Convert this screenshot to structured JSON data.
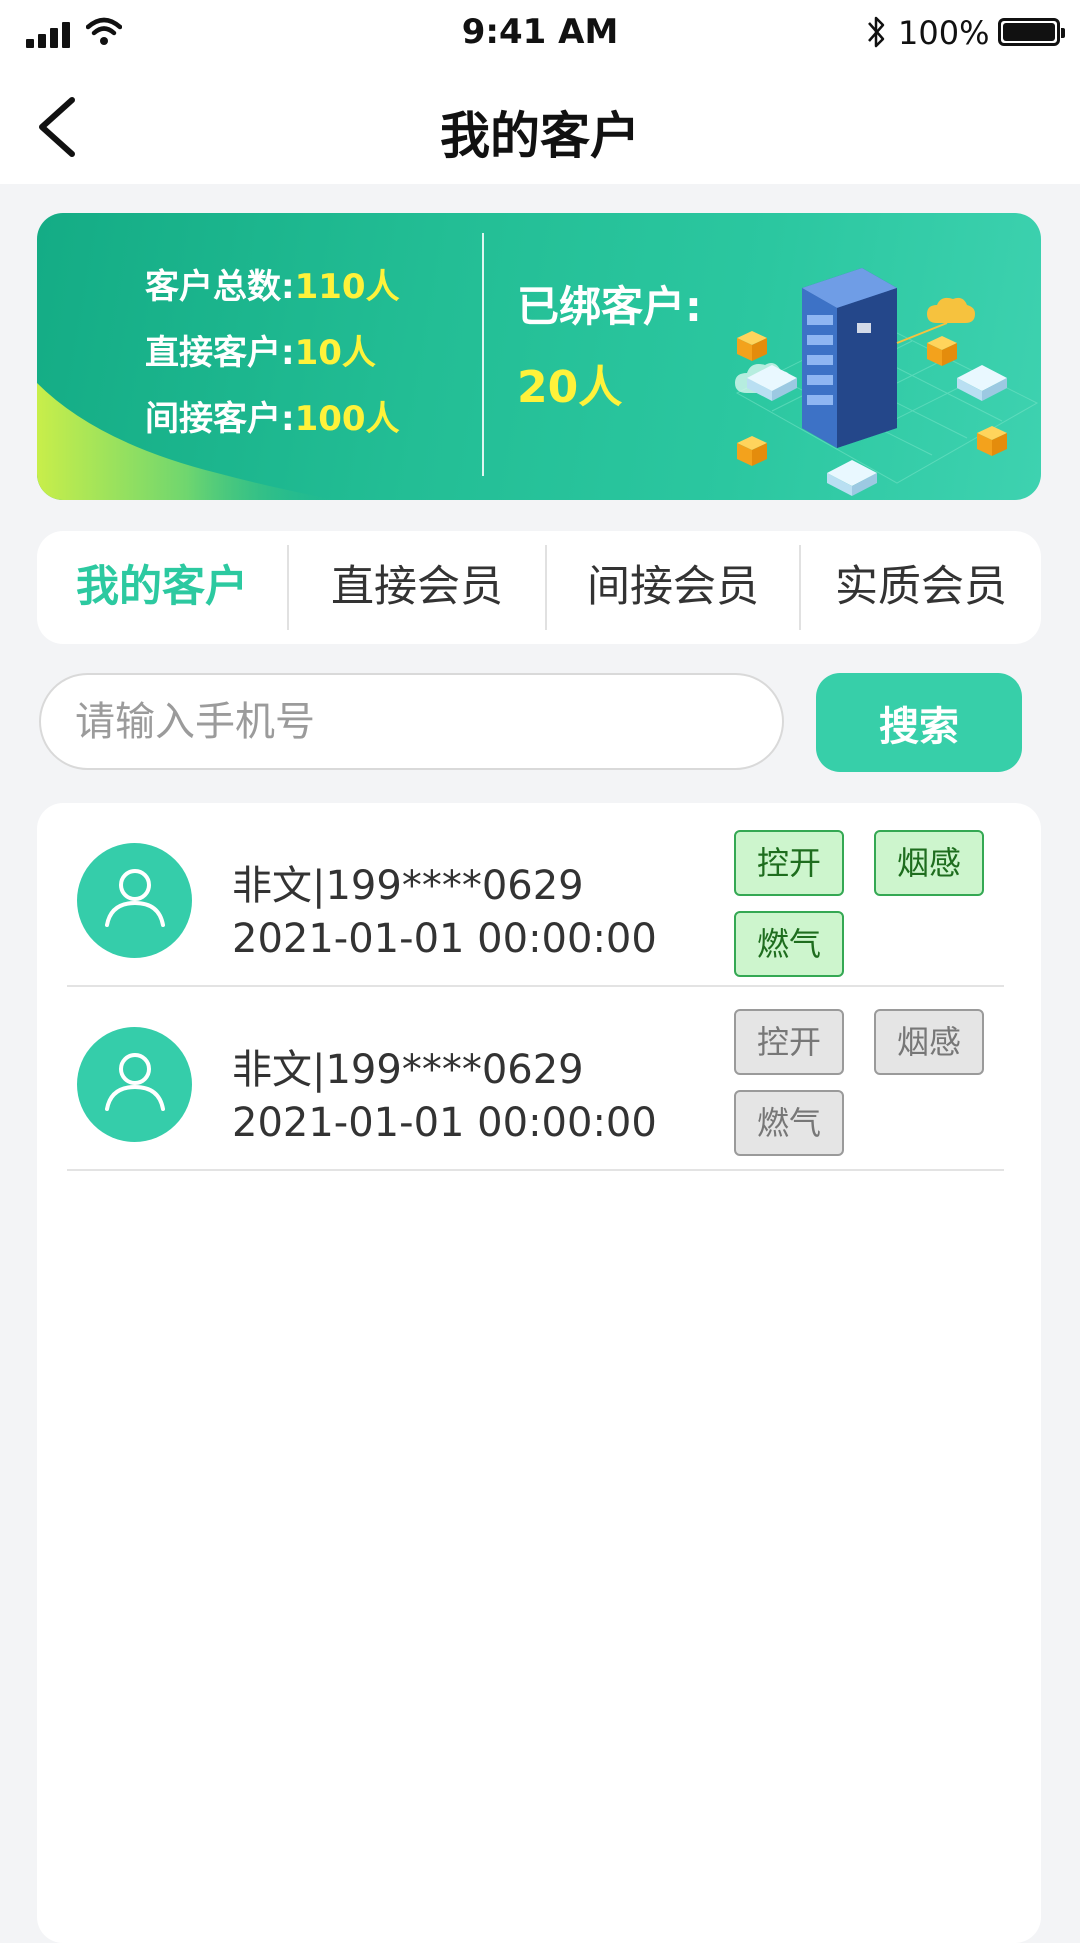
{
  "status_bar": {
    "time": "9:41 AM",
    "battery": "100%",
    "icons": [
      "signal-icon",
      "wifi-icon",
      "bluetooth-icon",
      "battery-icon"
    ]
  },
  "nav": {
    "title": "我的客户",
    "back_icon": "chevron-left-icon"
  },
  "banner": {
    "total_label": "客户总数:",
    "total_value": "110人",
    "direct_label": "直接客户:",
    "direct_value": "10人",
    "indirect_label": "间接客户:",
    "indirect_value": "100人",
    "bound_label": "已绑客户:",
    "bound_value": "20人",
    "accent_color": "#fff23a",
    "bg_color": "#23be95"
  },
  "tabs": [
    {
      "label": "我的客户",
      "active": true
    },
    {
      "label": "直接会员",
      "active": false
    },
    {
      "label": "间接会员",
      "active": false
    },
    {
      "label": "实质会员",
      "active": false
    }
  ],
  "search": {
    "placeholder": "请输入手机号",
    "value": "",
    "button_label": "搜索"
  },
  "customers": [
    {
      "name_phone": "非文|199****0629",
      "datetime": "2021-01-01  00:00:00",
      "tags": [
        {
          "label": "控开",
          "active": true
        },
        {
          "label": "烟感",
          "active": true
        },
        {
          "label": "燃气",
          "active": true
        }
      ]
    },
    {
      "name_phone": "非文|199****0629",
      "datetime": "2021-01-01  00:00:00",
      "tags": [
        {
          "label": "控开",
          "active": false
        },
        {
          "label": "烟感",
          "active": false
        },
        {
          "label": "燃气",
          "active": false
        }
      ]
    }
  ],
  "colors": {
    "primary": "#37cfa9",
    "active_tab": "#2cc9a0",
    "tag_on_bg": "#cdf5cd",
    "tag_on_border": "#34a853",
    "tag_off_bg": "#e5e5e5"
  }
}
